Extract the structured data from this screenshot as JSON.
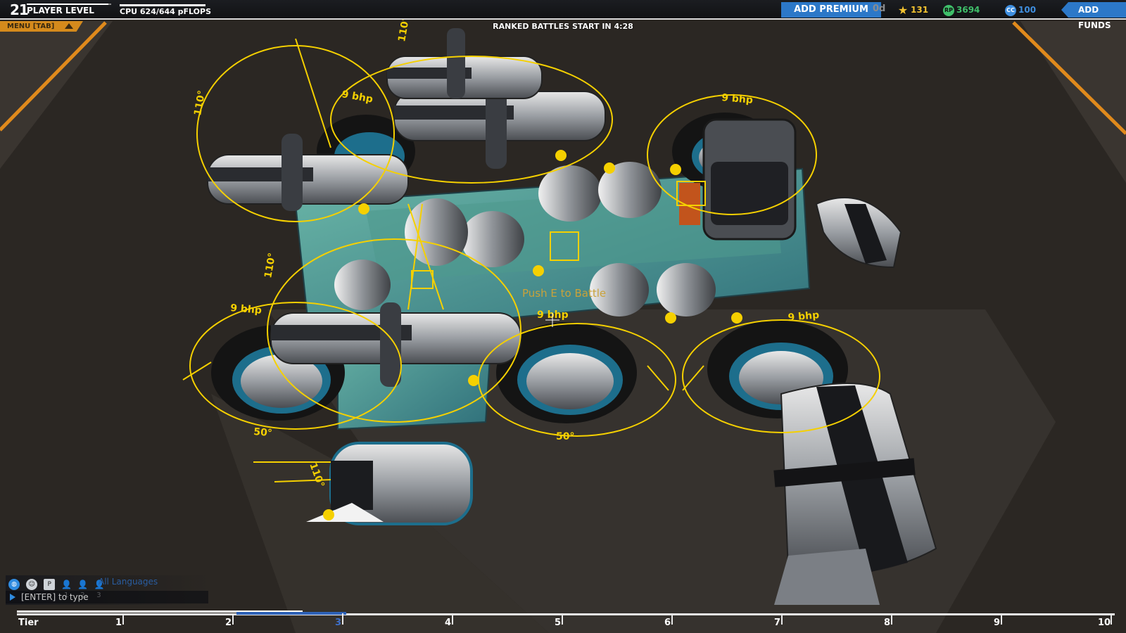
{
  "player": {
    "level": "21",
    "level_label": "PLAYER LEVEL",
    "level_progress": 0.97
  },
  "cpu": {
    "label": "CPU 624/644 pFLOPS",
    "used": 624,
    "max": 644
  },
  "menu": {
    "label": "MENU [TAB]"
  },
  "notice": {
    "ranked": "RANKED BATTLES START IN 4:28"
  },
  "premium": {
    "button_label": "ADD PREMIUM",
    "days": "0d"
  },
  "resources": {
    "stars": "131",
    "robits": "3694",
    "robits_icon": "RP",
    "cosmetic": "100",
    "cosmetic_icon": "CC"
  },
  "funds": {
    "button_label": "ADD FUNDS"
  },
  "scene": {
    "push_label": "Push E to Battle",
    "annotations": [
      {
        "text": "9 bhp"
      },
      {
        "text": "9 bhp"
      },
      {
        "text": "9 bhp"
      },
      {
        "text": "9 bhp"
      },
      {
        "text": "9 bhp"
      },
      {
        "text": "110°"
      },
      {
        "text": "110°"
      },
      {
        "text": "110°"
      },
      {
        "text": "110°"
      },
      {
        "text": "50°"
      },
      {
        "text": "50°"
      }
    ]
  },
  "chat": {
    "language": "All Languages",
    "input_placeholder": "[ENTER] to type",
    "filters": [
      "1",
      "2",
      "3"
    ]
  },
  "tiers": {
    "label": "Tier",
    "values": [
      "1",
      "2",
      "3",
      "4",
      "5",
      "6",
      "7",
      "8",
      "9",
      "10"
    ],
    "current": "3",
    "progress": 0.26
  },
  "colors": {
    "accent_blue": "#2c78c8",
    "menu_orange": "#d48a1c",
    "annotation_yellow": "#f5d000",
    "floor": "#2a2622"
  }
}
